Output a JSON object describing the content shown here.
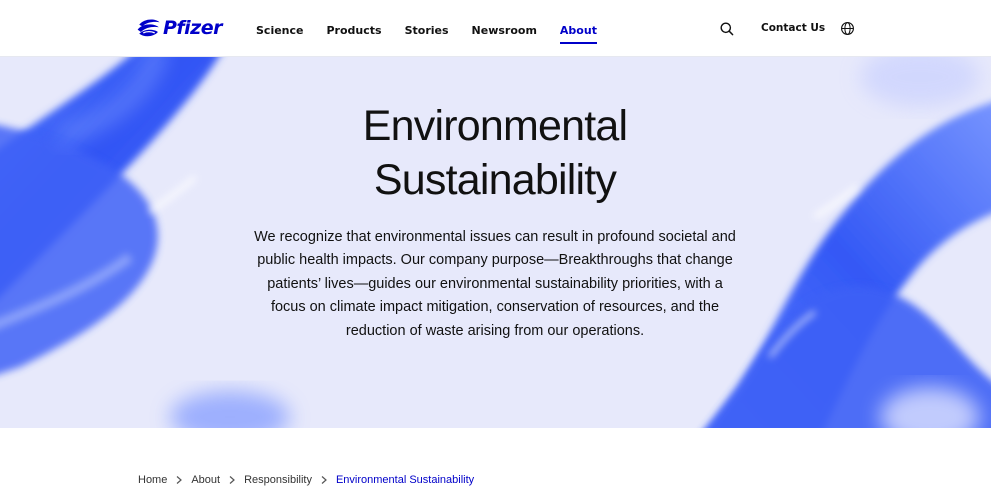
{
  "brand": {
    "name": "Pfizer",
    "color": "#0000c9"
  },
  "nav": {
    "items": [
      {
        "label": "Science",
        "active": false
      },
      {
        "label": "Products",
        "active": false
      },
      {
        "label": "Stories",
        "active": false
      },
      {
        "label": "Newsroom",
        "active": false
      },
      {
        "label": "About",
        "active": true
      }
    ],
    "contact_label": "Contact Us",
    "icons": [
      "search-icon",
      "globe-icon"
    ]
  },
  "hero": {
    "title_line1": "Environmental",
    "title_line2": "Sustainability",
    "body": "We recognize that environmental issues can result in profound societal and public health impacts. Our company purpose—Breakthroughs that change patients’ lives—guides our environmental sustainability priorities, with a focus on climate impact mitigation, conservation of resources, and the reduction of waste arising from our operations.",
    "background_color": "#e7e9fb",
    "accent_color": "#3b5bff"
  },
  "breadcrumb": {
    "items": [
      "Home",
      "About",
      "Responsibility",
      "Environmental Sustainability"
    ]
  }
}
